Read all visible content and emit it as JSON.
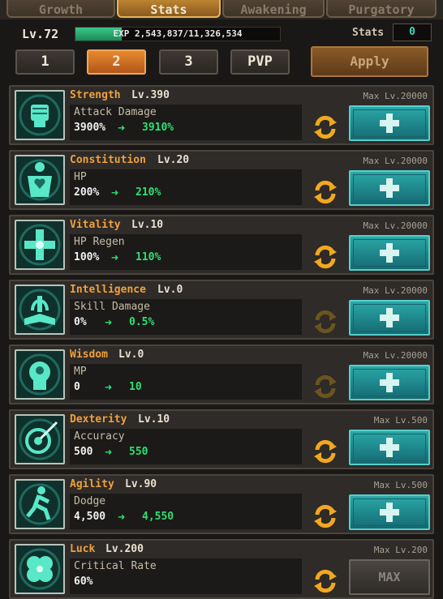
{
  "tabs": [
    {
      "label": "Growth",
      "active": false
    },
    {
      "label": "Stats",
      "active": true
    },
    {
      "label": "Awakening",
      "active": false
    },
    {
      "label": "Purgatory",
      "active": false
    }
  ],
  "player": {
    "level": "Lv.72",
    "exp_text": "EXP 2,543,837/11,326,534",
    "exp_fraction": 0.225,
    "stats_label": "Stats",
    "stats_points": "0"
  },
  "presets": [
    {
      "label": "1",
      "active": false
    },
    {
      "label": "2",
      "active": true
    },
    {
      "label": "3",
      "active": false
    },
    {
      "label": "PVP",
      "active": false
    }
  ],
  "apply_label": "Apply",
  "stats": [
    {
      "name": "Strength",
      "level": "Lv.390",
      "max": "Max Lv.20000",
      "detail": "Attack Damage",
      "from": "3900%",
      "to": "3910%",
      "icon": "fist-icon",
      "can_reset": true,
      "button": "plus"
    },
    {
      "name": "Constitution",
      "level": "Lv.20",
      "max": "Max Lv.20000",
      "detail": "HP",
      "from": "200%",
      "to": "210%",
      "icon": "heart-body-icon",
      "can_reset": true,
      "button": "plus"
    },
    {
      "name": "Vitality",
      "level": "Lv.10",
      "max": "Max Lv.20000",
      "detail": "HP Regen",
      "from": "100%",
      "to": "110%",
      "icon": "cross-icon",
      "can_reset": true,
      "button": "plus"
    },
    {
      "name": "Intelligence",
      "level": "Lv.0",
      "max": "Max Lv.20000",
      "detail": "Skill Damage",
      "from": "0%",
      "to": "0.5%",
      "icon": "book-icon",
      "can_reset": false,
      "button": "plus"
    },
    {
      "name": "Wisdom",
      "level": "Lv.0",
      "max": "Max Lv.20000",
      "detail": "MP",
      "from": "0",
      "to": "10",
      "icon": "head-icon",
      "can_reset": false,
      "button": "plus"
    },
    {
      "name": "Dexterity",
      "level": "Lv.10",
      "max": "Max Lv.500",
      "detail": "Accuracy",
      "from": "500",
      "to": "550",
      "icon": "target-icon",
      "can_reset": true,
      "button": "plus"
    },
    {
      "name": "Agility",
      "level": "Lv.90",
      "max": "Max Lv.500",
      "detail": "Dodge",
      "from": "4,500",
      "to": "4,550",
      "icon": "running-figure-icon",
      "can_reset": true,
      "button": "plus"
    },
    {
      "name": "Luck",
      "level": "Lv.200",
      "max": "Max Lv.200",
      "detail": "Critical Rate",
      "from": "60%",
      "to": "",
      "icon": "clover-icon",
      "can_reset": true,
      "button": "max",
      "button_label": "MAX"
    }
  ],
  "colors": {
    "accent_orange": "#f0a03c",
    "increase_green": "#2ee070",
    "plus_teal": "#2aa8a8",
    "exp_green": "#3ac888"
  }
}
